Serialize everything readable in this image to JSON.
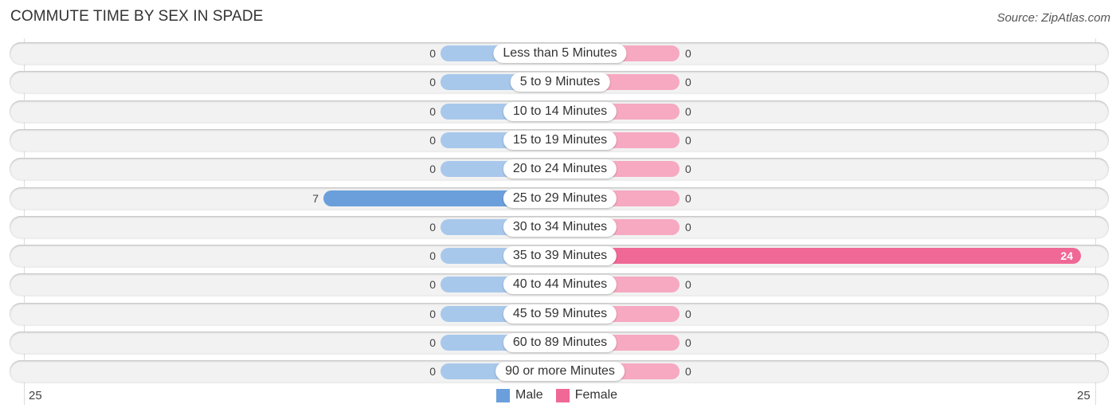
{
  "header": {
    "title": "COMMUTE TIME BY SEX IN SPADE",
    "source": "Source: ZipAtlas.com"
  },
  "colors": {
    "male": "#6a9fdb",
    "male_light": "#a8c8eb",
    "female": "#f06895",
    "female_light": "#f6a9c1"
  },
  "chart_data": {
    "type": "bar",
    "orientation": "horizontal-diverging",
    "title": "COMMUTE TIME BY SEX IN SPADE",
    "categories": [
      "Less than 5 Minutes",
      "5 to 9 Minutes",
      "10 to 14 Minutes",
      "15 to 19 Minutes",
      "20 to 24 Minutes",
      "25 to 29 Minutes",
      "30 to 34 Minutes",
      "35 to 39 Minutes",
      "40 to 44 Minutes",
      "45 to 59 Minutes",
      "60 to 89 Minutes",
      "90 or more Minutes"
    ],
    "series": [
      {
        "name": "Male",
        "values": [
          0,
          0,
          0,
          0,
          0,
          7,
          0,
          0,
          0,
          0,
          0,
          0
        ]
      },
      {
        "name": "Female",
        "values": [
          0,
          0,
          0,
          0,
          0,
          0,
          0,
          24,
          0,
          0,
          0,
          0
        ]
      }
    ],
    "axis": {
      "left_tick": "25",
      "right_tick": "25",
      "max": 25
    },
    "legend": {
      "position": "bottom-center",
      "entries": [
        "Male",
        "Female"
      ]
    }
  }
}
